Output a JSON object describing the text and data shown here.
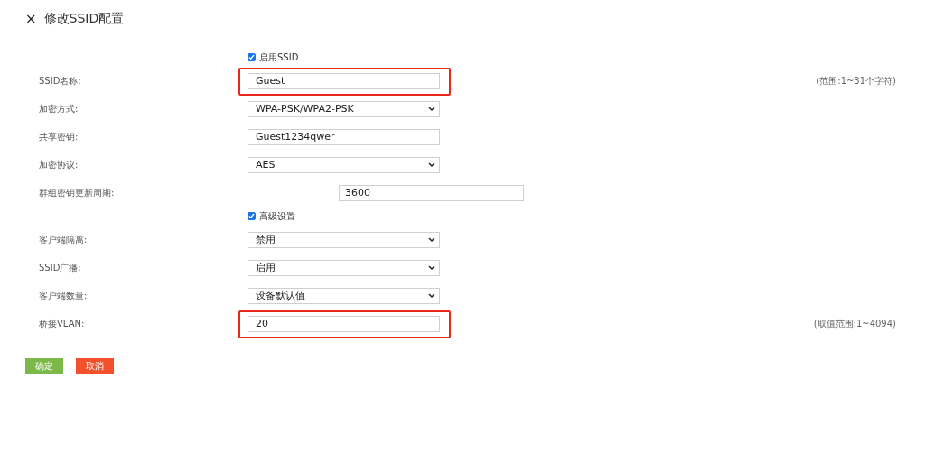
{
  "header": {
    "close": "×",
    "title": "修改SSID配置"
  },
  "rows": [
    {
      "kind": "checkbox",
      "label": "启用SSID",
      "checked": true
    },
    {
      "kind": "input",
      "label": "SSID名称:",
      "value": "Guest",
      "hint": "(范围:1~31个字符)",
      "highlighted": true
    },
    {
      "kind": "select",
      "label": "加密方式:",
      "value": "WPA-PSK/WPA2-PSK"
    },
    {
      "kind": "input",
      "label": "共享密钥:",
      "value": "Guest1234qwer"
    },
    {
      "kind": "select",
      "label": "加密协议:",
      "value": "AES"
    },
    {
      "kind": "input-offset",
      "label": "群组密钥更新周期:",
      "value": "3600"
    },
    {
      "kind": "checkbox",
      "label": "高级设置",
      "checked": true
    },
    {
      "kind": "select",
      "label": "客户端隔离:",
      "value": "禁用"
    },
    {
      "kind": "select",
      "label": "SSID广播:",
      "value": "启用"
    },
    {
      "kind": "select",
      "label": "客户端数量:",
      "value": "设备默认值"
    },
    {
      "kind": "input",
      "label": "桥接VLAN:",
      "value": "20",
      "hint": "(取值范围:1~4094)",
      "highlighted": true
    }
  ],
  "buttons": [
    {
      "label": "确定",
      "kind": "confirm"
    },
    {
      "label": "取消",
      "kind": "cancel"
    }
  ]
}
